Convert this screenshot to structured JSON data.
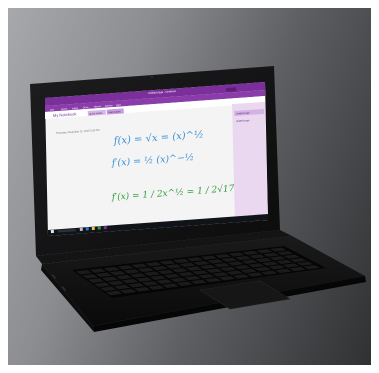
{
  "onenote": {
    "window_title": "Untitled page - OneNote",
    "ribbon_tabs": [
      "File",
      "Home",
      "Insert",
      "Draw",
      "History",
      "Review",
      "View"
    ],
    "notebook_name": "My Notebook",
    "section_tabs": [
      "Quick Notes",
      "Math Notes"
    ],
    "page_list": [
      "Untitled page",
      "Untitled page"
    ],
    "page_timestamp": "Thursday, November 12, 2015    5:26 PM",
    "equations": [
      "f(x) = √x = (x)^½",
      "f′(x) = ½ (x)^−½",
      "f′(x) = 1 / 2x^½ = 1 / 2√17"
    ],
    "colors": {
      "accent": "#7b2f9b",
      "ink_blue": "#3a8fd6",
      "ink_red": "#e0322d",
      "ink_green": "#2f9e3c"
    }
  },
  "taskbar": {
    "icons": [
      "windows-icon",
      "search-icon",
      "task-view-icon",
      "edge-icon",
      "folder-icon",
      "store-icon",
      "onenote-icon"
    ]
  }
}
